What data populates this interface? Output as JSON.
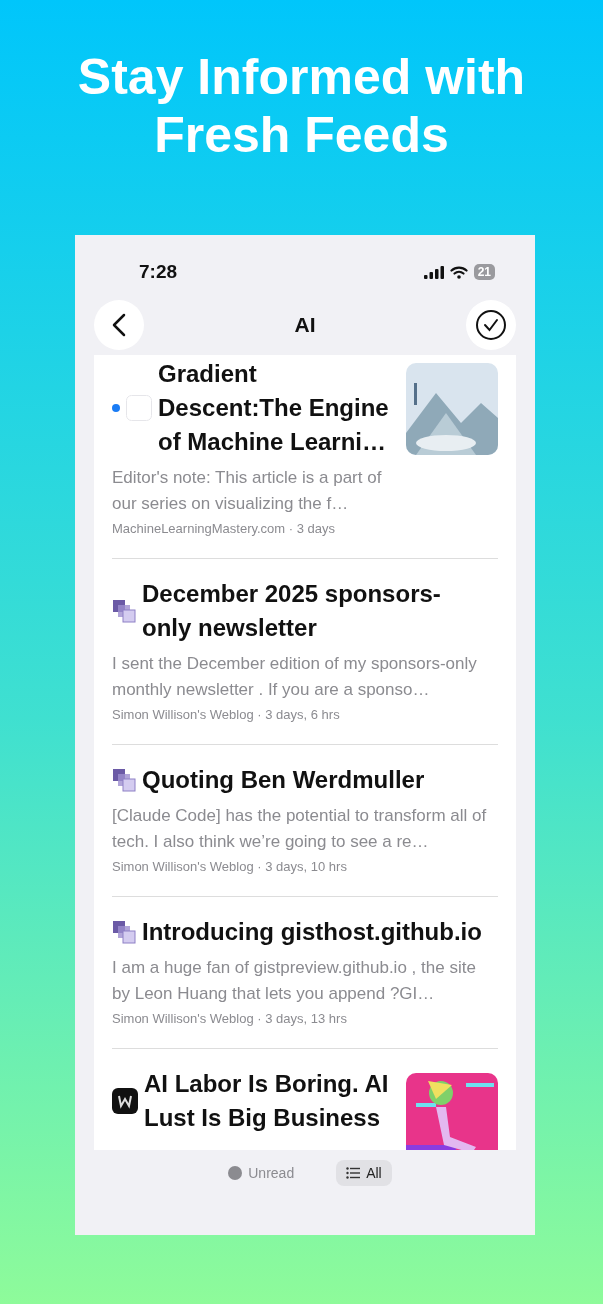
{
  "headline": "Stay Informed with Fresh Feeds",
  "status_bar": {
    "time": "7:28",
    "battery": "21"
  },
  "nav": {
    "title": "AI"
  },
  "articles": [
    {
      "favicon": {
        "kind": "blank"
      },
      "unread": true,
      "title": "Gradient Descent:The Engine of Machine Learni…",
      "excerpt": "Editor's note: This article is a part of our series on visualizing the f…",
      "meta": "MachineLearningMastery.com · 3 days"
    },
    {
      "favicon": {
        "kind": "stack"
      },
      "unread": false,
      "title": "December 2025 sponsors-only newsletter",
      "excerpt": "I sent the December edition of my sponsors-only monthly newsletter . If you are a sponso…",
      "meta": "Simon Willison's Weblog · 3 days, 6 hrs"
    },
    {
      "favicon": {
        "kind": "stack"
      },
      "unread": false,
      "title": "Quoting Ben Werdmuller",
      "excerpt": "[Claude Code] has the potential to transform all of tech. I also think we’re going to see a re…",
      "meta": "Simon Willison's Weblog · 3 days, 10 hrs"
    },
    {
      "favicon": {
        "kind": "stack"
      },
      "unread": false,
      "title": "Introducing gisthost.github.io",
      "excerpt": "I am a huge fan of gistpreview.github.io , the site by Leon Huang that lets you append ?GI…",
      "meta": "Simon Willison's Weblog · 3 days, 13 hrs"
    },
    {
      "favicon": {
        "kind": "w"
      },
      "unread": false,
      "title": "AI Labor Is Boring. AI Lust Is Big Business"
    }
  ],
  "filter_tabs": [
    {
      "label": "Unread",
      "kind": "dot",
      "selected": false
    },
    {
      "label": "All",
      "kind": "list",
      "selected": true
    }
  ]
}
